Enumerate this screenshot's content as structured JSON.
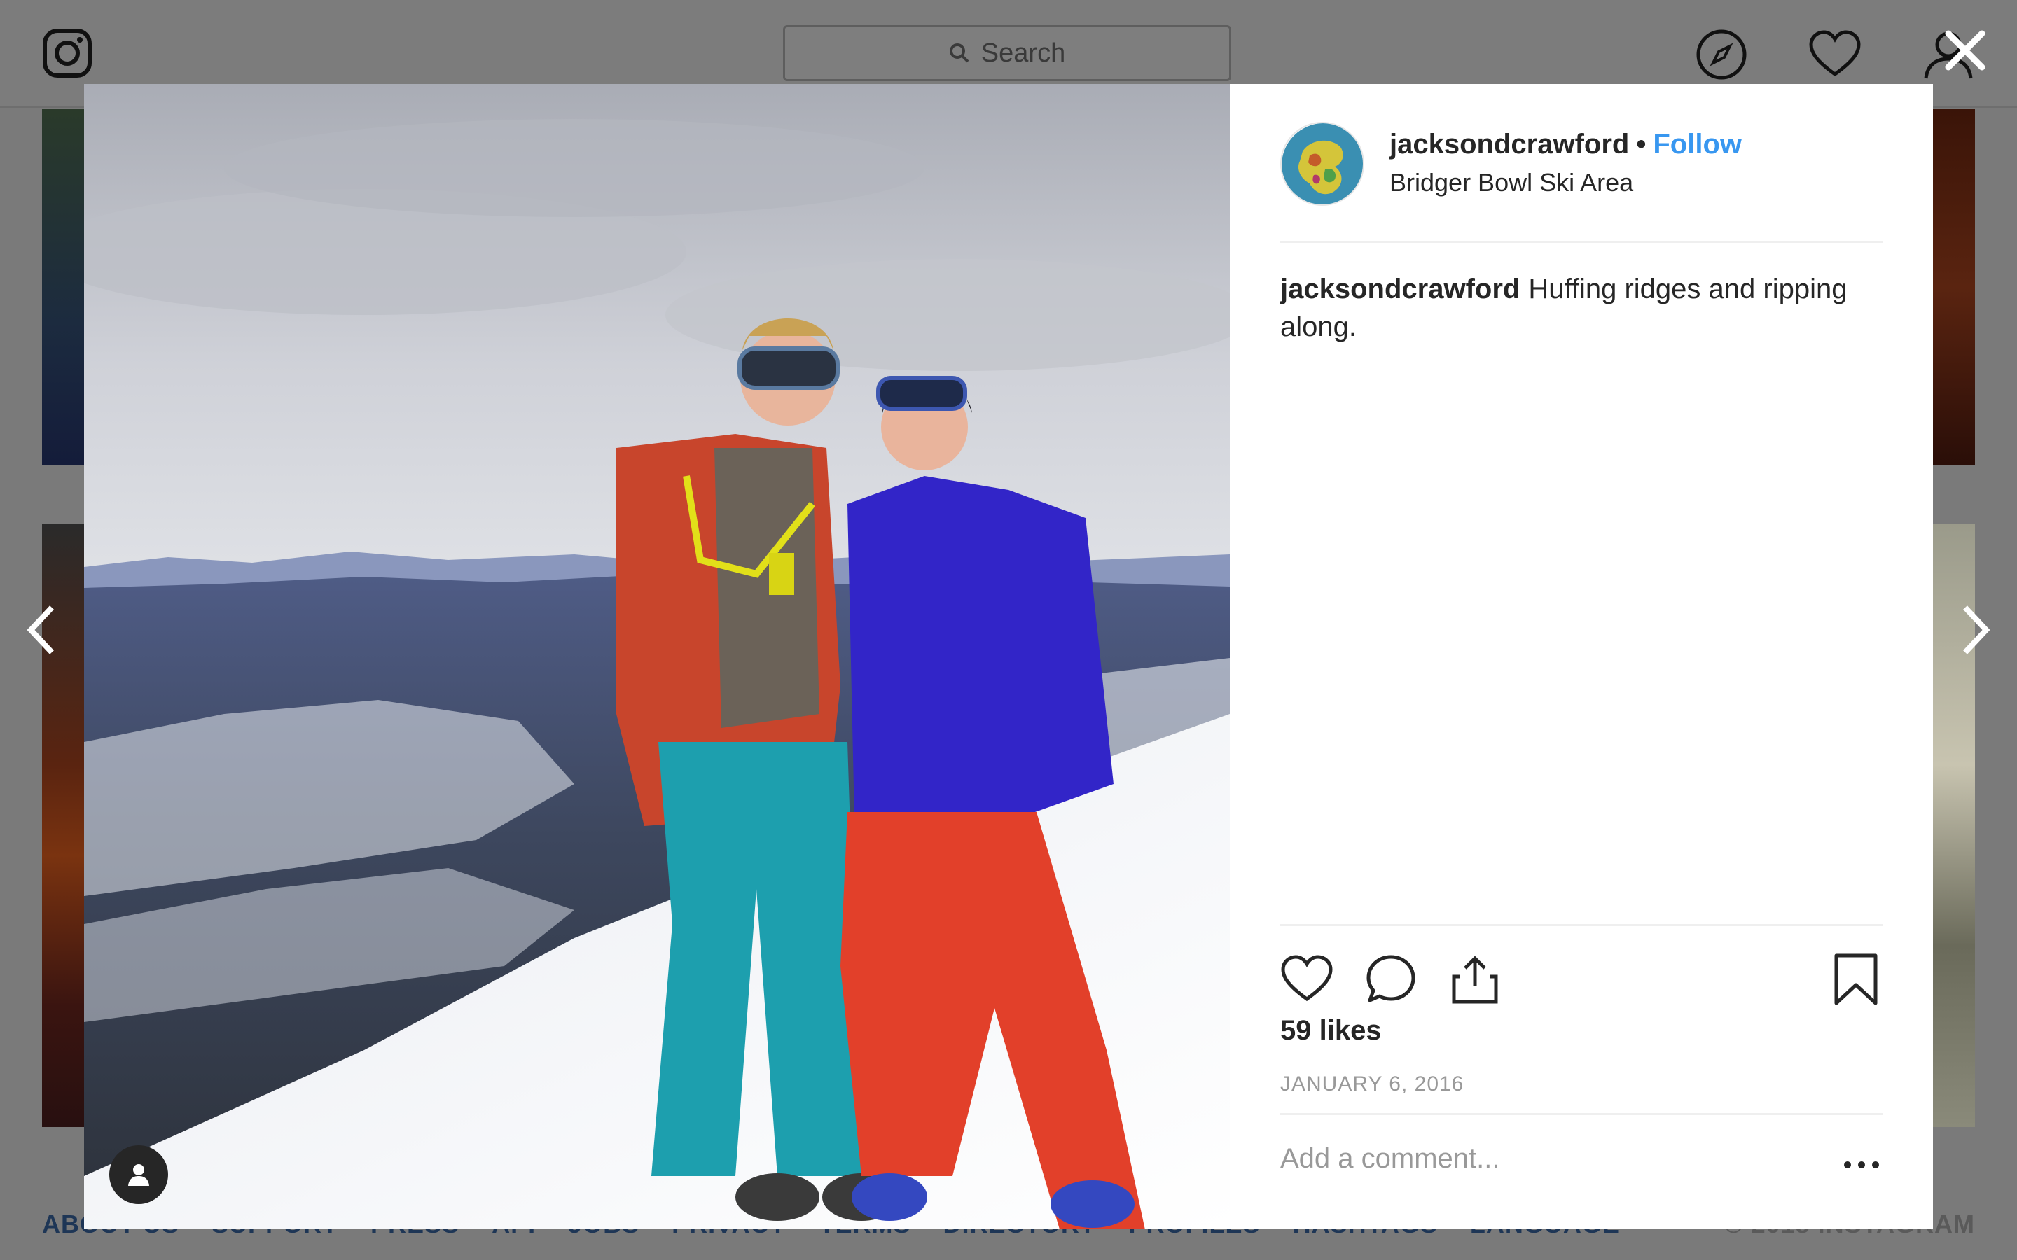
{
  "topbar": {
    "search_placeholder": "Search"
  },
  "footer": {
    "links": [
      "ABOUT US",
      "SUPPORT",
      "PRESS",
      "API",
      "JOBS",
      "PRIVACY",
      "TERMS",
      "DIRECTORY",
      "PROFILES",
      "HASHTAGS",
      "LANGUAGE"
    ],
    "copyright": "© 2018 INSTAGRAM"
  },
  "post": {
    "username": "jacksondcrawford",
    "separator": "•",
    "follow_label": "Follow",
    "location": "Bridger Bowl Ski Area",
    "caption_username": "jacksondcrawford",
    "caption_text": "Huffing ridges and ripping along.",
    "likes": "59 likes",
    "date": "JANUARY 6, 2016",
    "comment_placeholder": "Add a comment..."
  },
  "colors": {
    "accent": "#3897f0",
    "text": "#262626",
    "muted": "#999999",
    "overlay": "#7a7a7a"
  },
  "icons": {
    "close": "close-icon",
    "prev": "chevron-left-icon",
    "next": "chevron-right-icon",
    "like": "heart-icon",
    "comment": "comment-bubble-icon",
    "share": "share-icon",
    "save": "bookmark-icon",
    "more": "ellipsis-icon",
    "tag": "user-tag-icon"
  }
}
